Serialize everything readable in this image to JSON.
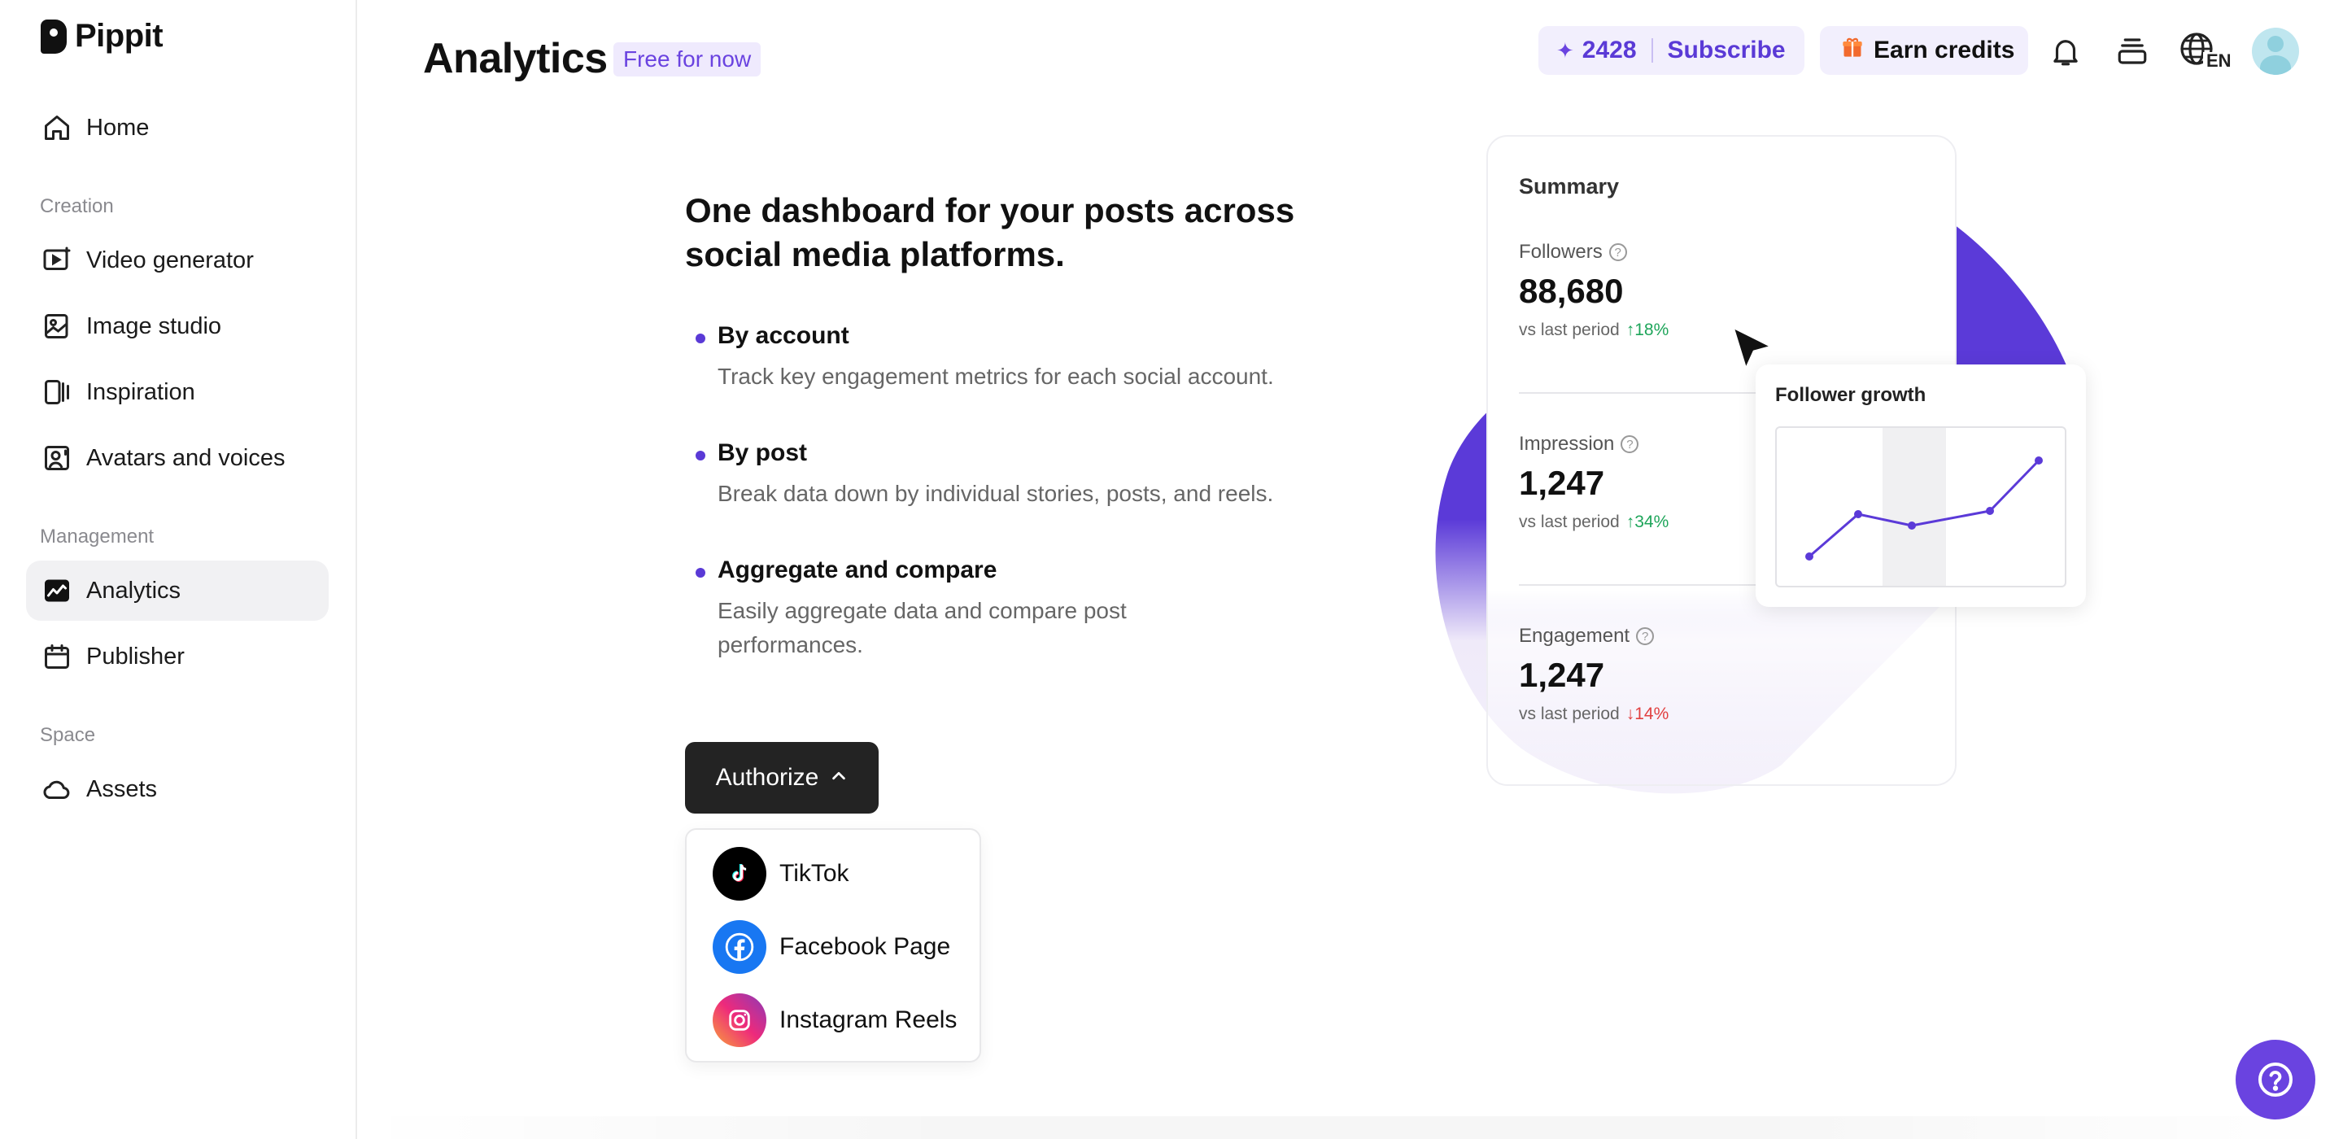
{
  "app": {
    "logo_text": "Pippit"
  },
  "sidebar": {
    "items": [
      {
        "label": "Home",
        "icon": "home-icon"
      },
      {
        "label": "Video generator",
        "icon": "video-generator-icon"
      },
      {
        "label": "Image studio",
        "icon": "image-studio-icon"
      },
      {
        "label": "Inspiration",
        "icon": "inspiration-icon"
      },
      {
        "label": "Avatars and voices",
        "icon": "avatar-voice-icon"
      },
      {
        "label": "Analytics",
        "icon": "analytics-icon",
        "active": true
      },
      {
        "label": "Publisher",
        "icon": "calendar-icon"
      },
      {
        "label": "Assets",
        "icon": "cloud-icon"
      }
    ],
    "sections": {
      "creation": "Creation",
      "management": "Management",
      "space": "Space"
    }
  },
  "header": {
    "title": "Analytics",
    "badge": "Free for now",
    "credits": "2428",
    "subscribe_label": "Subscribe",
    "earn_label": "Earn credits",
    "language": "EN"
  },
  "main": {
    "headline": "One dashboard for your posts across social media platforms.",
    "features": [
      {
        "title": "By account",
        "description": "Track key engagement metrics for each social account."
      },
      {
        "title": "By post",
        "description": "Break data down by individual stories, posts, and reels."
      },
      {
        "title": "Aggregate and compare",
        "description": "Easily aggregate data and compare post performances."
      }
    ],
    "authorize_label": "Authorize",
    "platforms": [
      {
        "label": "TikTok",
        "icon": "tiktok-icon"
      },
      {
        "label": "Facebook Page",
        "icon": "facebook-icon"
      },
      {
        "label": "Instagram Reels",
        "icon": "instagram-icon"
      }
    ]
  },
  "summary": {
    "title": "Summary",
    "compare_label": "vs last period",
    "metrics": [
      {
        "label": "Followers",
        "value": "88,680",
        "change": "18%",
        "direction": "up"
      },
      {
        "label": "Impression",
        "value": "1,247",
        "change": "34%",
        "direction": "up"
      },
      {
        "label": "Engagement",
        "value": "1,247",
        "change": "14%",
        "direction": "down"
      }
    ],
    "growth_title": "Follower growth"
  },
  "colors": {
    "accent": "#6a43e0",
    "up": "#1ea55a",
    "down": "#e14040",
    "button_dark": "#232323"
  }
}
